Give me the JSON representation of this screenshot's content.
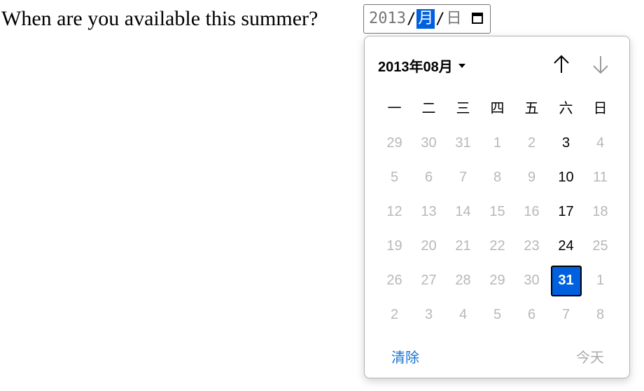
{
  "question": "When are you available this summer?",
  "date_input": {
    "year": "2013",
    "month": "月",
    "day": "日",
    "separator": "/"
  },
  "picker": {
    "month_year": "2013年08月",
    "weekdays": [
      "一",
      "二",
      "三",
      "四",
      "五",
      "六",
      "日"
    ],
    "rows": [
      [
        "29",
        "30",
        "31",
        "1",
        "2",
        "3",
        "4"
      ],
      [
        "5",
        "6",
        "7",
        "8",
        "9",
        "10",
        "11"
      ],
      [
        "12",
        "13",
        "14",
        "15",
        "16",
        "17",
        "18"
      ],
      [
        "19",
        "20",
        "21",
        "22",
        "23",
        "24",
        "25"
      ],
      [
        "26",
        "27",
        "28",
        "29",
        "30",
        "31",
        "1"
      ],
      [
        "2",
        "3",
        "4",
        "5",
        "6",
        "7",
        "8"
      ]
    ],
    "enabled": [
      [
        false,
        false,
        false,
        false,
        false,
        true,
        false
      ],
      [
        false,
        false,
        false,
        false,
        false,
        true,
        false
      ],
      [
        false,
        false,
        false,
        false,
        false,
        true,
        false
      ],
      [
        false,
        false,
        false,
        false,
        false,
        true,
        false
      ],
      [
        false,
        false,
        false,
        false,
        false,
        true,
        false
      ],
      [
        false,
        false,
        false,
        false,
        false,
        false,
        false
      ]
    ],
    "selected_day": "31",
    "clear_label": "清除",
    "today_label": "今天",
    "colors": {
      "selected_bg": "#0060df",
      "link": "#1673d6",
      "disabled_text": "#b8b8b8"
    }
  }
}
